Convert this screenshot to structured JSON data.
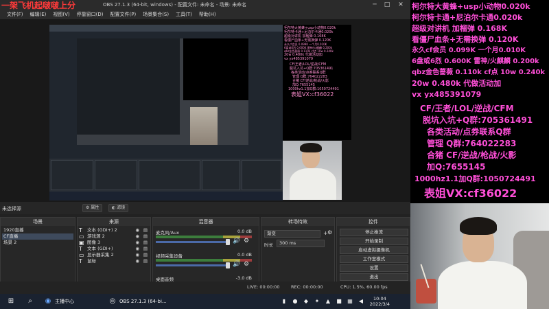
{
  "overlay_title": "一架飞机起啵啵上分",
  "window": {
    "title": "OBS 27.1.3 (64-bit, windows) - 配置文件: 未命名 - 场景: 未命名",
    "minimize": "─",
    "maximize": "□",
    "close": "✕"
  },
  "menu": [
    "文件(F)",
    "编辑(E)",
    "视图(V)",
    "停靠窗口(D)",
    "配置文件(P)",
    "场景集合(S)",
    "工具(T)",
    "帮助(H)"
  ],
  "right_overlay": {
    "lines": [
      "柯尔特大黄蜂+usp小动物0.020k",
      "柯尔特卡通+尼泊尔卡通0.020k",
      "超级对讲机 加榴弹 0.168K",
      "看僵尸血条+无需换弹 0.120K",
      "永久cf会员 0.099K   一个月0.010K",
      "6盘或6烈  0.600K    雷神/火麒麟 0.200k",
      "qbz金色蔷薇  0.110k  cf点 10w 0.240k",
      "20w 0.480k  代做活动加",
      "vx   yx485391079"
    ],
    "lines2": [
      "CF/王者/LOL/逆战/CFM",
      "脱坑入坑+Q群:705361491",
      "各类活动/点券联系Q群",
      "管理  Q群:764022283",
      "合猪  CF/逆战/枪战/火影",
      "加Q:7655145",
      "1000hz1.1加Q群:1050724491"
    ],
    "footer": "表姐VX:cf36022"
  },
  "preview_overlay": {
    "lines": [
      "柯尔特大黄蜂+usp小动物0.020k",
      "柯尔特卡通+尼泊尔卡通0.020k",
      "超级对讲机 加榴弹 0.168K",
      "看僵尸血条+无需换弹 0.120K",
      "永久cf会员 0.099K  一个月0.010K",
      "6盘或6烈 0.600K  雷神/火麒麟 0.200k",
      "qbz金色蔷薇 0.110k  cf点 10w 0.240k",
      "20w 0.480k  代做活动加",
      "vx   yx485391079"
    ],
    "lines2": [
      "CF/王者/LOL/逆战/CFM",
      "脱坑入坑+Q群:705361491",
      "各类活动/点券联系Q群",
      "管理  Q群:764022283",
      "合猪  CF/逆战/枪战/火影",
      "加Q:7655145",
      "1000hz1.1加Q群:1050724491"
    ],
    "footer": "表姐VX:cf36022"
  },
  "source_bar": {
    "label": "未选择源",
    "properties": "属性",
    "filters": "滤镜"
  },
  "scenes": {
    "title": "场景",
    "items": [
      "1920直播",
      "CF直播",
      "场景 2"
    ],
    "selected": 1
  },
  "sources": {
    "title": "来源",
    "items": [
      {
        "icon": "T",
        "name": "文本 (GDI+) 2"
      },
      {
        "icon": "▭",
        "name": "游戏源 2"
      },
      {
        "icon": "▣",
        "name": "图像 3"
      },
      {
        "icon": "T",
        "name": "文本 (GDI+)"
      },
      {
        "icon": "▭",
        "name": "显示器采集 2"
      },
      {
        "icon": "T",
        "name": "鼠标"
      }
    ]
  },
  "mixer": {
    "title": "混音器",
    "channels": [
      {
        "name": "麦克风/Aux",
        "db": "0.0 dB"
      },
      {
        "name": "视频采集设备",
        "db": "0.0 dB"
      },
      {
        "name": "桌面音频",
        "db": "-3.0 dB"
      }
    ]
  },
  "transitions": {
    "title": "转场特效",
    "type": "渐变",
    "duration_label": "时长",
    "duration": "300 ms"
  },
  "controls": {
    "title": "控件",
    "buttons": [
      "停止推流",
      "开始录制",
      "启动虚拟摄像机",
      "工作室模式",
      "设置",
      "退出"
    ]
  },
  "status": {
    "live": "LIVE: 00:00:00",
    "rec": "REC: 00:00:00",
    "cpu": "CPU: 1.5%, 60.00 fps"
  },
  "taskbar": {
    "app1": "主播中心",
    "app2": "OBS 27.1.3 (64-bi...",
    "time": "10:04",
    "date": "2022/3/4"
  }
}
